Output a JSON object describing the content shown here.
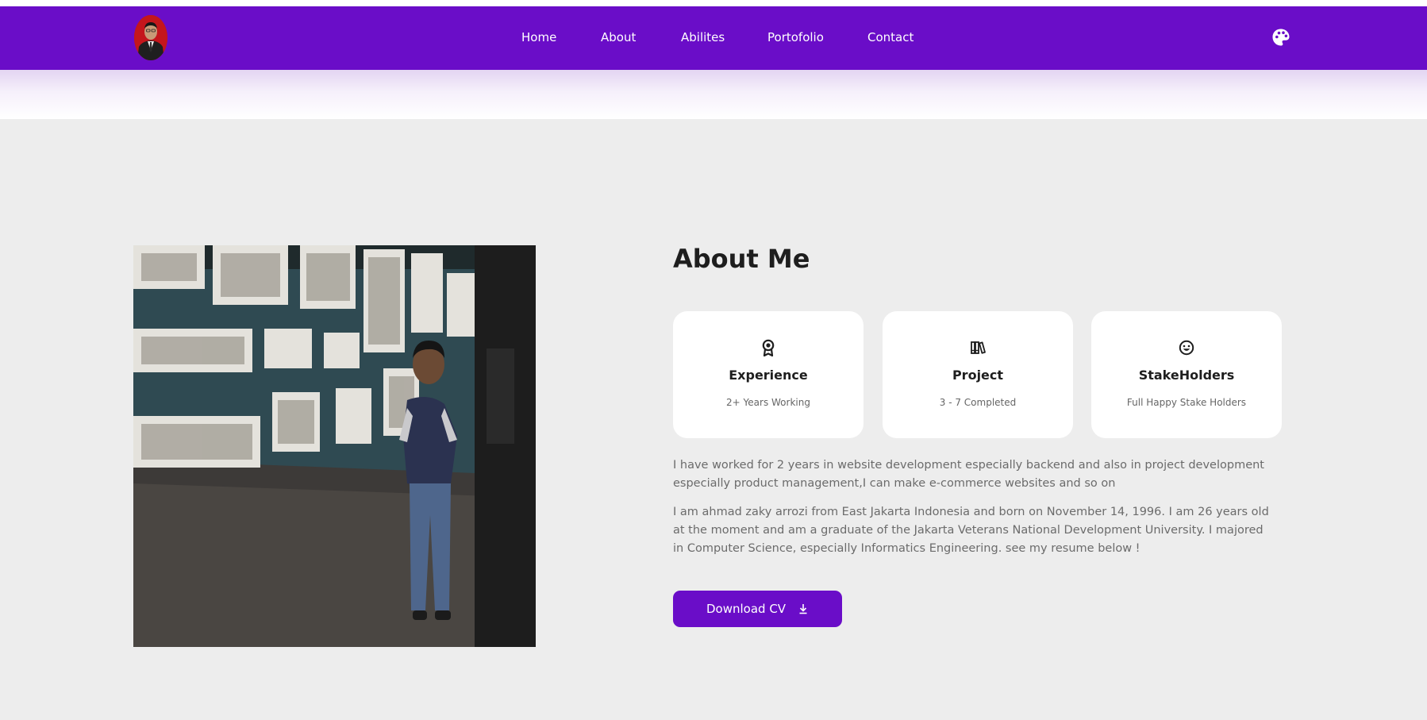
{
  "nav": {
    "links": [
      "Home",
      "About",
      "Abilites",
      "Portofolio",
      "Contact"
    ]
  },
  "about": {
    "title": "About Me",
    "cards": [
      {
        "icon": "award-icon",
        "title": "Experience",
        "subtitle": "2+ Years Working"
      },
      {
        "icon": "books-icon",
        "title": "Project",
        "subtitle": "3 - 7 Completed"
      },
      {
        "icon": "smile-icon",
        "title": "StakeHolders",
        "subtitle": "Full Happy Stake Holders"
      }
    ],
    "paragraphs": [
      "I have worked for 2 years in website development especially backend and also in project development especially product management,I can make e-commerce websites and so on",
      "I am ahmad zaky arrozi from East Jakarta Indonesia and born on November 14, 1996. I am 26 years old at the moment and am a graduate of the Jakarta Veterans National Development University. I majored in Computer Science, especially Informatics Engineering. see my resume below !"
    ],
    "cta_label": "Download CV"
  },
  "colors": {
    "brand": "#6a0dc8",
    "page_bg": "#ededed",
    "card_bg": "#ffffff",
    "heading": "#1e1e1e",
    "body_text": "#6b6b6b"
  }
}
